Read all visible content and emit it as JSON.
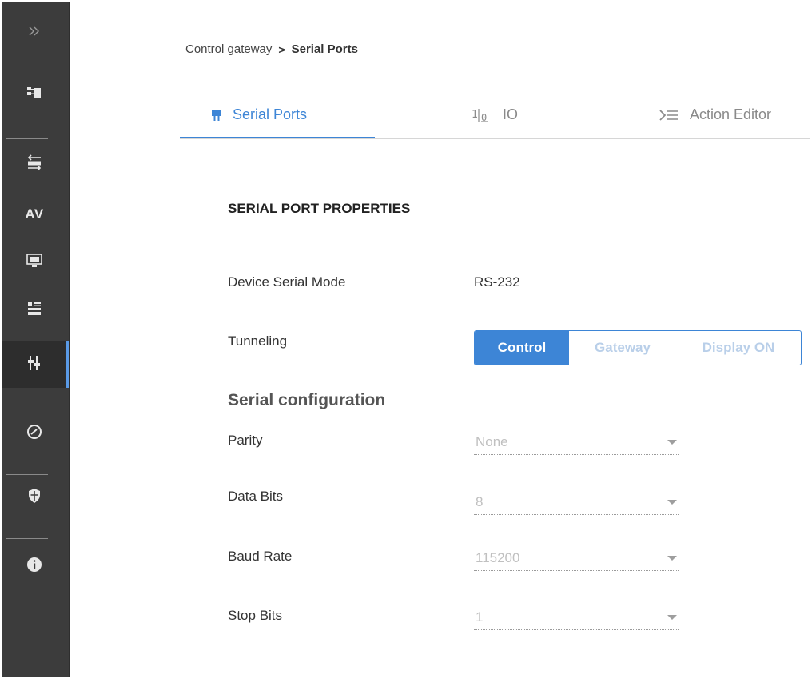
{
  "breadcrumb": {
    "parent": "Control gateway",
    "separator": ">",
    "current": "Serial Ports"
  },
  "tabs": [
    {
      "label": "Serial Ports",
      "icon": "serial-port-icon",
      "active": true
    },
    {
      "label": "IO",
      "icon": "io-icon",
      "active": false
    },
    {
      "label": "Action Editor",
      "icon": "action-editor-icon",
      "active": false
    }
  ],
  "sidebar": {
    "items": [
      {
        "name": "expand",
        "icon": "double-chevron-right-icon"
      },
      {
        "name": "routing",
        "icon": "routing-icon"
      },
      {
        "name": "auto-switching",
        "icon": "auto-switch-icon"
      },
      {
        "name": "av",
        "label": "AV"
      },
      {
        "name": "edid",
        "icon": "edid-icon"
      },
      {
        "name": "settings",
        "icon": "settings-icon"
      },
      {
        "name": "control-gateway",
        "icon": "control-gateway-icon",
        "active": true
      },
      {
        "name": "diagnostics",
        "icon": "gauge-icon"
      },
      {
        "name": "security",
        "icon": "shield-icon"
      },
      {
        "name": "about",
        "icon": "info-icon"
      }
    ]
  },
  "properties": {
    "title": "SERIAL PORT PROPERTIES",
    "device_serial_mode": {
      "label": "Device Serial Mode",
      "value": "RS-232"
    },
    "tunneling": {
      "label": "Tunneling",
      "options": [
        "Control",
        "Gateway",
        "Display ON"
      ],
      "selected": "Control"
    }
  },
  "serial_config": {
    "title": "Serial configuration",
    "parity": {
      "label": "Parity",
      "value": "None"
    },
    "data_bits": {
      "label": "Data Bits",
      "value": "8"
    },
    "baud_rate": {
      "label": "Baud Rate",
      "value": "115200"
    },
    "stop_bits": {
      "label": "Stop Bits",
      "value": "1"
    }
  },
  "colors": {
    "accent": "#3d85d6",
    "sidebar_bg": "#3c3c3c"
  }
}
